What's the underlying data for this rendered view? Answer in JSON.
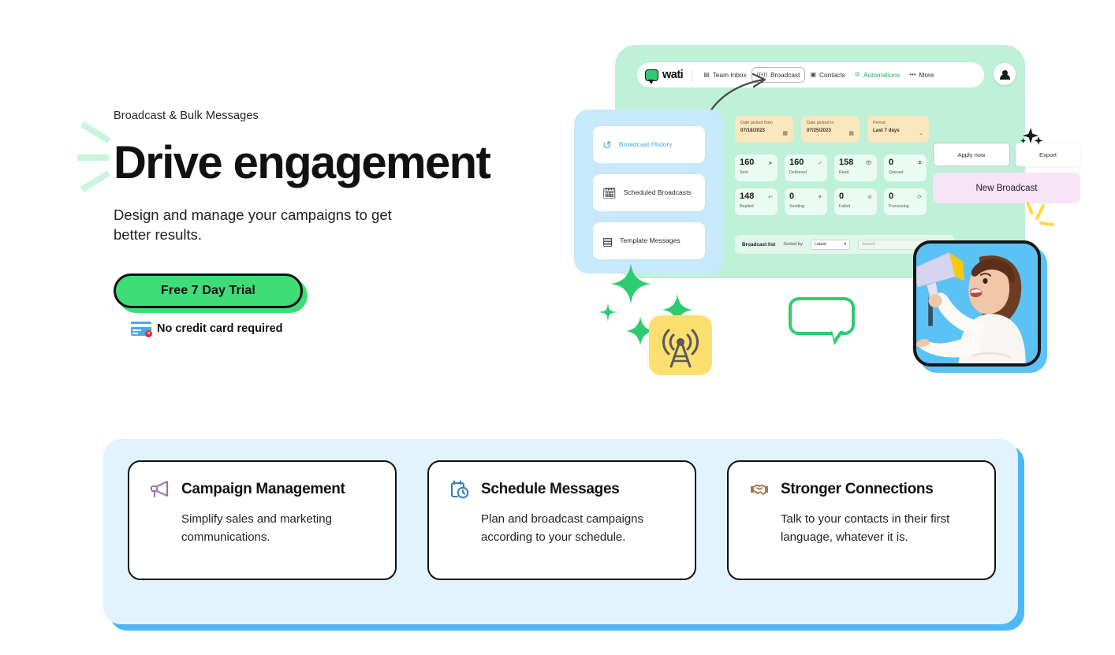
{
  "hero": {
    "eyebrow": "Broadcast & Bulk Messages",
    "headline": "Drive engagement",
    "subhead": "Design and manage your campaigns to get better results.",
    "cta_label": "Free 7 Day Trial",
    "no_credit_card": "No credit card required"
  },
  "mockup": {
    "brand": "wati",
    "nav": [
      {
        "label": "Team Inbox",
        "icon": "inbox-icon",
        "active": false,
        "green": false
      },
      {
        "label": "Broadcast",
        "icon": "broadcast-icon",
        "active": true,
        "green": false
      },
      {
        "label": "Contacts",
        "icon": "contacts-icon",
        "active": false,
        "green": false
      },
      {
        "label": "Automations",
        "icon": "automations-icon",
        "active": false,
        "green": true
      },
      {
        "label": "More",
        "icon": "more-icon",
        "active": false,
        "green": false
      }
    ],
    "sidebar": [
      {
        "label": "Broadcast History",
        "icon": "history-icon",
        "active": true
      },
      {
        "label": "Scheduled Broadcasts",
        "icon": "calendar-clock-icon",
        "active": false
      },
      {
        "label": "Template Messages",
        "icon": "message-template-icon",
        "active": false
      }
    ],
    "filters": [
      {
        "label": "Date picked from",
        "value": "07/18/2023",
        "icon": "calendar-icon"
      },
      {
        "label": "Date picked to",
        "value": "07/25/2023",
        "icon": "calendar-icon"
      },
      {
        "label": "Period",
        "value": "Last 7 days",
        "icon": "chevron-down-icon"
      }
    ],
    "stats_row1": [
      {
        "value": "160",
        "label": "Sent",
        "icon": "send-icon"
      },
      {
        "value": "160",
        "label": "Delivered",
        "icon": "delivered-icon"
      },
      {
        "value": "158",
        "label": "Read",
        "icon": "read-icon"
      },
      {
        "value": "0",
        "label": "Queued",
        "icon": "queue-icon"
      }
    ],
    "stats_row2": [
      {
        "value": "148",
        "label": "Replied",
        "icon": "reply-icon"
      },
      {
        "value": "0",
        "label": "Sending",
        "icon": "sending-icon"
      },
      {
        "value": "0",
        "label": "Failed",
        "icon": "failed-icon"
      },
      {
        "value": "0",
        "label": "Processing",
        "icon": "processing-icon"
      }
    ],
    "buttons": {
      "apply": "Apply now",
      "export": "Export",
      "new_broadcast": "New Broadcast"
    },
    "list_bar": {
      "title": "Broadcast list",
      "sorted_by_label": "Sorted by",
      "sort_value": "Latest",
      "search_placeholder": "Search"
    }
  },
  "features": [
    {
      "title": "Campaign Management",
      "desc": "Simplify sales and marketing communications.",
      "icon": "megaphone-icon",
      "color": "#9b6fb0"
    },
    {
      "title": "Schedule Messages",
      "desc": "Plan and broadcast campaigns according to your schedule.",
      "icon": "calendar-clock-icon",
      "color": "#2b7fbd"
    },
    {
      "title": "Stronger Connections",
      "desc": "Talk to your contacts in their first language, whatever it is.",
      "icon": "handshake-icon",
      "color": "#a07a4e"
    }
  ],
  "theme": {
    "brand_green": "#3fdd78",
    "mint_panel": "#bff0d8",
    "sidebar_blue": "#c8e8fb",
    "band_blue": "#e1f3fd",
    "band_shadow_blue": "#4db8f5",
    "yellow": "#fcdf6e",
    "pink": "#f7e4f7"
  }
}
